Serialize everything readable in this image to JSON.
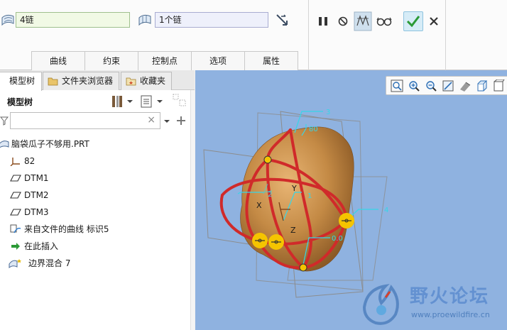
{
  "ribbon": {
    "chain_field_1": "4链",
    "chain_field_2": "1个链",
    "tabs": [
      "曲线",
      "约束",
      "控制点",
      "选项",
      "属性"
    ]
  },
  "nav": {
    "tabs": [
      "模型树",
      "文件夹浏览器",
      "收藏夹"
    ]
  },
  "tree": {
    "title": "模型树",
    "filter_clear": "×",
    "items": [
      {
        "label": "脑袋瓜子不够用.PRT",
        "icon": "part-icon"
      },
      {
        "label": "82",
        "icon": "coordinate-system-icon"
      },
      {
        "label": "DTM1",
        "icon": "datum-plane-icon"
      },
      {
        "label": "DTM2",
        "icon": "datum-plane-icon"
      },
      {
        "label": "DTM3",
        "icon": "datum-plane-icon"
      },
      {
        "label": "来自文件的曲线 标识5",
        "icon": "curve-from-file-icon"
      },
      {
        "label": "在此插入",
        "icon": "insert-here-arrow-icon"
      },
      {
        "label": "边界混合 7",
        "icon": "boundary-blend-icon"
      }
    ]
  },
  "viewport": {
    "labels": {
      "chain_3": "3",
      "value_80": "80",
      "chain_2": "2",
      "chain_1": "1",
      "chain_4": "4",
      "value_00": "0.0",
      "axis_x": "X",
      "axis_y": "Y",
      "axis_z": "Z"
    },
    "watermark_title": "野火论坛",
    "watermark_url": "www.proewildfire.cn"
  },
  "colors": {
    "viewport_bg": "#8fb2e0",
    "surface": "#c48a45",
    "curve": "#d02a2a",
    "handle": "#f5c400",
    "annotation": "#36d6e8",
    "ok_button": "#d6ecf7"
  }
}
